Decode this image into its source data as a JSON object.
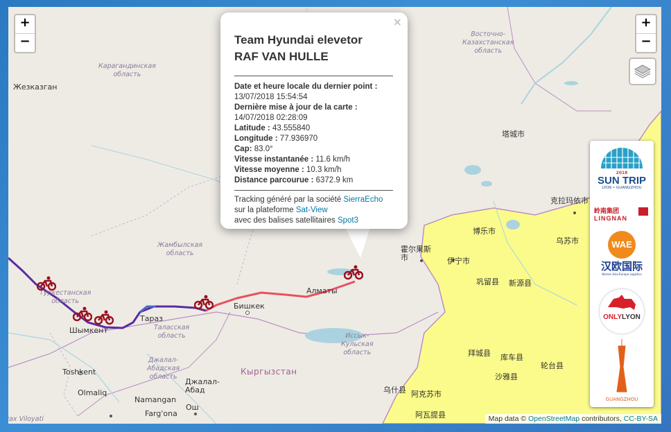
{
  "popup": {
    "close": "×",
    "team": "Team Hyundai elevetor",
    "rider": "RAF VAN HULLE",
    "fields": [
      {
        "label": "Date et heure locale du dernier point :",
        "value": "13/07/2018 15:54:54",
        "newline": true
      },
      {
        "label": "Dernière mise à jour de la carte :",
        "value": "14/07/2018 02:28:09",
        "newline": true
      },
      {
        "label": "Latitude :",
        "value": "43.555840",
        "newline": false
      },
      {
        "label": "Longitude :",
        "value": "77.936970",
        "newline": false
      },
      {
        "label": "Cap:",
        "value": "83.0°",
        "newline": false
      },
      {
        "label": "Vitesse instantanée :",
        "value": "11.6 km/h",
        "newline": false
      },
      {
        "label": "Vitesse moyenne :",
        "value": "10.3 km/h",
        "newline": false
      },
      {
        "label": "Distance parcourue :",
        "value": "6372.9 km",
        "newline": false
      }
    ],
    "footer": {
      "line1_prefix": "Tracking généré par la société ",
      "line1_link": "SierraEcho",
      "line2_prefix": "sur la plateforme ",
      "line2_link": "Sat-View",
      "line3_prefix": "avec des balises satellitaires ",
      "line3_link": "Spot3"
    }
  },
  "zoom": {
    "in": "+",
    "out": "−"
  },
  "attribution": {
    "prefix": "Map data © ",
    "osm": "OpenStreetMap",
    "mid": " contributors, ",
    "license": "CC-BY-SA"
  },
  "labels": {
    "zhezkazgan": "Жезказган",
    "karaganda_region": "Карагандинская\nобласть",
    "east_kaz_region": "Восточно-\nКазахстанская\nобласть",
    "zhambyl_region": "Жамбылская\nобласть",
    "turkestan_region": "Туркестанская\nобласть",
    "shymkent": "Шымкент",
    "taraz": "Тараз",
    "talas_region": "Таласская\nобласть",
    "bishkek": "Бишкек",
    "almaty": "Алматы",
    "issyk_region": "Иссык-\nКульская\nобласть",
    "jalal_region": "Джалал-\nАбадская\nобласть",
    "jalal_abad": "Джалал-\nАбад",
    "kyrgyzstan": "Кыргызстан",
    "tashkent": "Toshkent",
    "olmaliq": "Olmaliq",
    "namangan": "Namangan",
    "osh": "Ош",
    "fargona": "Farg'ona",
    "viloyati": "zax Viloyati",
    "tacheng": "塔城市",
    "karamay": "克拉玛依市",
    "bole": "博乐市",
    "urumqi": "乌苏市",
    "horgos": "霍尔果斯\n市",
    "yining": "伊宁市",
    "gongliu": "巩留县",
    "xinyuan": "新源县",
    "baicheng": "拜城县",
    "kuqa": "库车县",
    "luntai": "轮台县",
    "xayar": "沙雅县",
    "wushi": "乌什县",
    "aksu": "阿克苏市",
    "awat": "阿瓦提县"
  },
  "sponsors": {
    "suntrip_title": "SUN TRIP",
    "suntrip_sub": "LYON • GUANGZHOU",
    "suntrip_year": "2018",
    "lingnan": "LINGNAN",
    "lingnan_cn": "岭南集团",
    "wae": "WAE",
    "wae_cn": "汉欧国际",
    "wae_sub": "Wuhan Asia-Europe Logistics",
    "onlylyon_a": "ONLY",
    "onlylyon_b": "LYON",
    "guangzhou": "GUANGZHOU"
  },
  "colors": {
    "china": "#fbfb8b",
    "route_purple": "#5a2ca0",
    "route_red": "#e8505b",
    "bike": "#9a1020",
    "water": "#aad3df",
    "link": "#0078a8"
  }
}
